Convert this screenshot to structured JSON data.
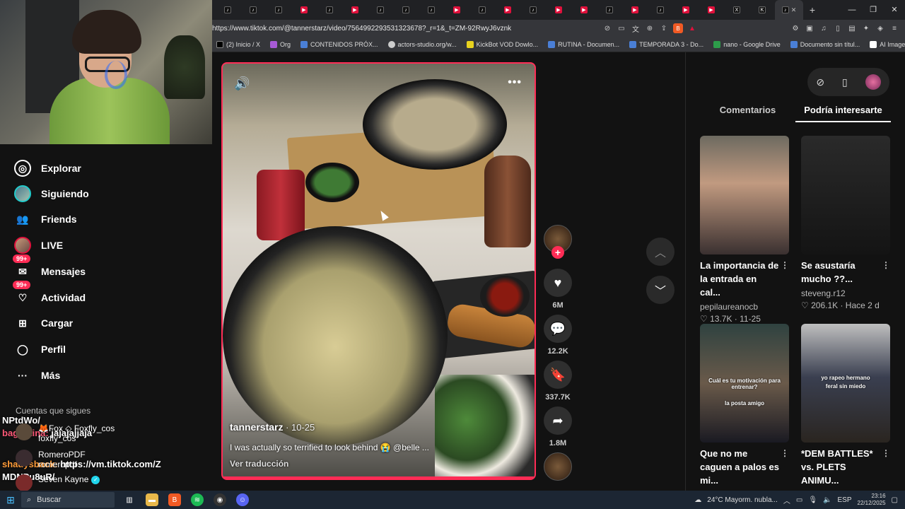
{
  "browser": {
    "tabs": [
      {
        "favicon": "tiktok",
        "yt": false
      },
      {
        "favicon": "tiktok",
        "yt": false
      },
      {
        "favicon": "tiktok",
        "yt": false
      },
      {
        "favicon": "youtube",
        "yt": true
      },
      {
        "favicon": "tiktok",
        "yt": false
      },
      {
        "favicon": "youtube",
        "yt": true
      },
      {
        "favicon": "tiktok",
        "yt": false
      },
      {
        "favicon": "tiktok",
        "yt": false
      },
      {
        "favicon": "tiktok",
        "yt": false
      },
      {
        "favicon": "youtube",
        "yt": true
      },
      {
        "favicon": "tiktok",
        "yt": false
      },
      {
        "favicon": "youtube",
        "yt": true
      },
      {
        "favicon": "tiktok",
        "yt": false
      },
      {
        "favicon": "youtube",
        "yt": true
      },
      {
        "favicon": "youtube",
        "yt": true
      },
      {
        "favicon": "tiktok",
        "yt": false
      },
      {
        "favicon": "youtube",
        "yt": true
      },
      {
        "favicon": "tiktok",
        "yt": false
      },
      {
        "favicon": "youtube",
        "yt": true
      },
      {
        "favicon": "youtube",
        "yt": true
      },
      {
        "favicon": "x",
        "yt": false
      },
      {
        "favicon": "kick",
        "yt": false
      }
    ],
    "active_tab_close": "✕",
    "new_tab": "+",
    "url": "https://www.tiktok.com/@tannerstarz/video/7564992293531323678?_r=1&_t=ZM-92RwyJ6vznk",
    "bookmarks": [
      {
        "label": "(2) Inicio / X",
        "icon": "x"
      },
      {
        "label": "Org",
        "icon": "p"
      },
      {
        "label": "CONTENIDOS PRÓX...",
        "icon": "doc"
      },
      {
        "label": "actors-studio.org/w...",
        "icon": "g"
      },
      {
        "label": "KickBot VOD Dowlo...",
        "icon": "y"
      },
      {
        "label": "RUTINA - Documen...",
        "icon": "doc"
      },
      {
        "label": "TEMPORADA 3 - Do...",
        "icon": "doc"
      },
      {
        "label": "nano - Google Drive",
        "icon": "dr"
      },
      {
        "label": "Documento sin títul...",
        "icon": "doc"
      },
      {
        "label": "AI Image Upscaler |...",
        "icon": "w"
      }
    ]
  },
  "sidebar": {
    "nav": [
      {
        "label": "Explorar",
        "icon": "compass-icon"
      },
      {
        "label": "Siguiendo",
        "icon": "avatar"
      },
      {
        "label": "Friends",
        "icon": "friends-icon"
      },
      {
        "label": "LIVE",
        "icon": "avatar2"
      },
      {
        "label": "Mensajes",
        "icon": "messages-icon",
        "badge": "99+"
      },
      {
        "label": "Actividad",
        "icon": "activity-icon",
        "badge": "99+"
      },
      {
        "label": "Cargar",
        "icon": "upload-icon"
      },
      {
        "label": "Perfil",
        "icon": "profile-icon"
      },
      {
        "label": "Más",
        "icon": "more-icon"
      }
    ],
    "following_heading": "Cuentas que sigues",
    "accounts": [
      {
        "display": "🦊Fox ◇ Foxfly_cos",
        "handle": "foxfly_cos"
      },
      {
        "display": "RomeroPDF",
        "handle": "romeropdf"
      },
      {
        "display": "Seven Kayne",
        "handle": "",
        "verified": true
      }
    ]
  },
  "chat": [
    {
      "user": "",
      "text": "NPtdWo/"
    },
    {
      "user": "bagustina:",
      "text": " jajajajjaja",
      "alt": true
    },
    {
      "user": "shadysback:",
      "text": " https://vm.tiktok.com/Z"
    },
    {
      "user": "",
      "text": "MDNPu8uR/"
    },
    {
      "user": "shadysback:",
      "text": " https://vm.tiktok.com/Z"
    },
    {
      "user": "",
      "text": "MDNPu8uR/"
    }
  ],
  "video": {
    "username": "tannerstarz",
    "date": " · 10-25",
    "caption": "I was actually so terrified to look behind 😭 @belle ...",
    "translate": "Ver traducción"
  },
  "actions": {
    "likes": "6M",
    "comments": "12.2K",
    "saves": "337.7K",
    "shares": "1.8M"
  },
  "right_panel": {
    "tabs": [
      "Comentarios",
      "Podría interesarte"
    ],
    "cards": [
      {
        "title": "La importancia de la entrada en cal...",
        "author": "pepilaureanocb",
        "meta": "♡ 13.7K · 11-25",
        "overlay": "",
        "overlay2": ""
      },
      {
        "title": "Se asustaría mucho ??...",
        "author": "steveng.r12",
        "meta": "♡ 206.1K · Hace 2 d",
        "overlay": "",
        "overlay2": ""
      },
      {
        "title": "Que no me caguen a palos es mi...",
        "author": "pichamarini2",
        "meta": "",
        "overlay": "Cuál es tu motivación para entrenar?",
        "overlay2": "la posta amigo"
      },
      {
        "title": "*DEM BATTLES* vs. PLETS ANIMU...",
        "author": "kaitos.freestyle",
        "meta": "",
        "overlay": "yo rapeo hermano",
        "overlay2": "feral sin miedo"
      }
    ]
  },
  "taskbar": {
    "search": "Buscar",
    "weather": "24°C  Mayorm. nubla...",
    "lang": "ESP",
    "time": "23:16",
    "date": "22/12/2025"
  }
}
